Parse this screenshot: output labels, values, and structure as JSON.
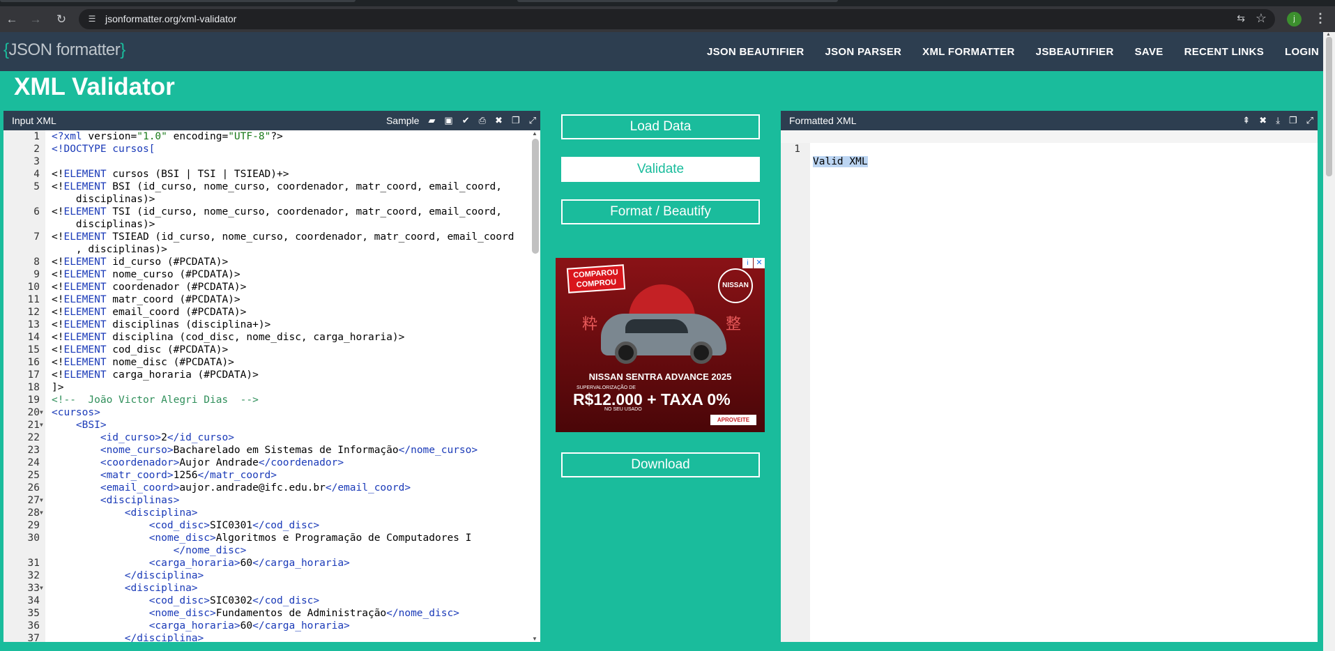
{
  "browser": {
    "url": "jsonformatter.org/xml-validator",
    "profile_initial": "j"
  },
  "site": {
    "logo_left_brace": "{",
    "logo_text": "JSON formatter",
    "logo_right_brace": "}",
    "nav": [
      "JSON BEAUTIFIER",
      "JSON PARSER",
      "XML FORMATTER",
      "JSBEAUTIFIER",
      "SAVE",
      "RECENT LINKS",
      "LOGIN"
    ],
    "page_title": "XML Validator"
  },
  "input_panel": {
    "title": "Input XML",
    "sample_label": "Sample"
  },
  "output_panel": {
    "title": "Formatted XML",
    "lines": [
      "Valid XML"
    ]
  },
  "buttons": {
    "load": "Load Data",
    "validate": "Validate",
    "format": "Format / Beautify",
    "download": "Download"
  },
  "ad": {
    "badge": "COMPAROU COMPROU",
    "brand": "NISSAN",
    "model": "NISSAN SENTRA ADVANCE 2025",
    "supervalorizacao": "SUPERVALORIZAÇÃO DE",
    "price": "R$12.000 + TAXA 0%",
    "usado": "NO SEU USADO",
    "cta": "APROVEITE",
    "kanji_left": "粋",
    "kanji_right": "整"
  },
  "icons": {
    "back": "arrow-left-icon",
    "forward": "arrow-right-icon",
    "reload": "reload-icon",
    "site_info": "tune-icon",
    "translate": "translate-icon",
    "bookmark": "star-icon",
    "menu": "kebab-icon"
  }
}
